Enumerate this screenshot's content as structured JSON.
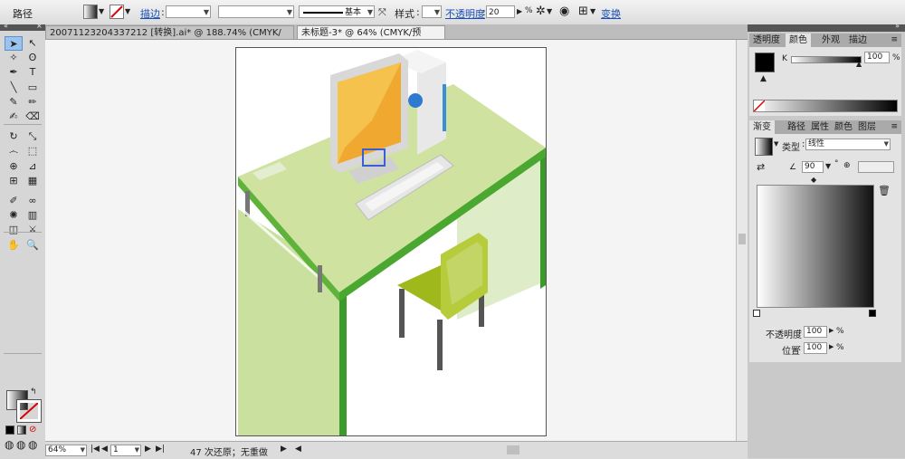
{
  "control_bar": {
    "object_type": "路径",
    "stroke_label": "描边",
    "stroke_weight": "",
    "stroke_profile": "基本",
    "style_label": "样式",
    "opacity_label": "不透明度",
    "opacity_value": "20",
    "opacity_unit": "%",
    "transform_label": "变换"
  },
  "doc_tabs": [
    {
      "title": "20071123204337212 [转换].ai* @ 188.74% (CMYK/预览)",
      "close": "⊠"
    },
    {
      "title": "未标题-3* @ 64% (CMYK/预览)",
      "close": "⊠"
    }
  ],
  "tools": [
    "selection-tool",
    "direct-selection-tool",
    "magic-wand-tool",
    "lasso-tool",
    "pen-tool",
    "type-tool",
    "line-tool",
    "rectangle-tool",
    "paintbrush-tool",
    "pencil-tool",
    "blob-brush-tool",
    "eraser-tool",
    "rotate-tool",
    "scale-tool",
    "warp-tool",
    "free-transform-tool",
    "shape-builder-tool",
    "perspective-tool",
    "mesh-tool",
    "gradient-tool",
    "eyedropper-tool",
    "blend-tool",
    "symbol-sprayer-tool",
    "column-graph-tool",
    "artboard-tool",
    "slice-tool",
    "hand-tool",
    "zoom-tool"
  ],
  "status_bar": {
    "zoom": "64%",
    "page": "1",
    "history": "47 次还原；无重做"
  },
  "color_panel": {
    "tabs": [
      "透明度",
      "颜色",
      "外观",
      "描边"
    ],
    "channel_label": "K",
    "channel_value": "100",
    "unit": "%"
  },
  "gradient_panel": {
    "tabs": [
      "渐变",
      "路径",
      "属性",
      "颜色",
      "图层"
    ],
    "type_label": "类型",
    "type_value": "线性",
    "angle_value": "90",
    "degree_symbol": "°",
    "opacity_label": "不透明度",
    "opacity_value": "100",
    "location_label": "位置",
    "location_value": "100",
    "unit": "%"
  },
  "colors": {
    "accent_blue": "#1a4fb8",
    "desk_top": "#cfe2a0",
    "desk_edge": "#5fb33a",
    "chair": "#b6cc3a",
    "monitor_screen": "#f0a830"
  }
}
